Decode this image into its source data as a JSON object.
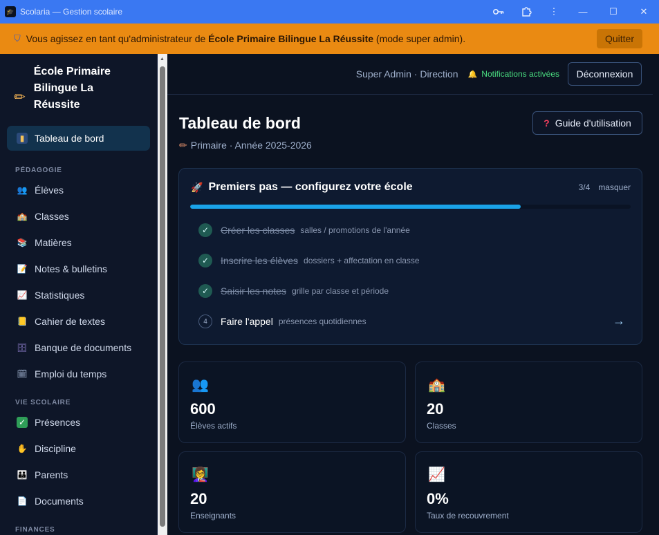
{
  "window": {
    "title": "Scolaria — Gestion scolaire",
    "controls": {
      "minimize": "—",
      "maximize": "☐",
      "close": "✕"
    }
  },
  "banner": {
    "prefix": "Vous agissez en tant qu'administrateur de",
    "school": "École Primaire Bilingue La Réussite",
    "suffix": "(mode super admin).",
    "quit_label": "Quitter"
  },
  "sidebar": {
    "brand": "École Primaire Bilingue La Réussite",
    "active": {
      "label": "Tableau de bord",
      "icon": "chart-icon"
    },
    "sections": [
      {
        "title": "PÉDAGOGIE",
        "items": [
          {
            "label": "Élèves",
            "icon": "students-icon"
          },
          {
            "label": "Classes",
            "icon": "school-icon"
          },
          {
            "label": "Matières",
            "icon": "books-icon"
          },
          {
            "label": "Notes & bulletins",
            "icon": "document-icon"
          },
          {
            "label": "Statistiques",
            "icon": "trend-icon"
          },
          {
            "label": "Cahier de textes",
            "icon": "notebook-icon"
          },
          {
            "label": "Banque de documents",
            "icon": "cabinet-icon"
          },
          {
            "label": "Emploi du temps",
            "icon": "calendar-icon"
          }
        ]
      },
      {
        "title": "VIE SCOLAIRE",
        "items": [
          {
            "label": "Présences",
            "icon": "check-icon"
          },
          {
            "label": "Discipline",
            "icon": "hand-icon"
          },
          {
            "label": "Parents",
            "icon": "family-icon"
          },
          {
            "label": "Documents",
            "icon": "page-icon"
          }
        ]
      },
      {
        "title": "FINANCES",
        "items": []
      }
    ]
  },
  "topbar": {
    "user": "Super Admin · Direction",
    "notifications": "Notifications activées",
    "logout": "Déconnexion"
  },
  "page": {
    "title": "Tableau de bord",
    "subtitle": "Primaire · Année 2025-2026",
    "guide_label": "Guide d'utilisation"
  },
  "onboarding": {
    "title": "Premiers pas — configurez votre école",
    "count": "3/4",
    "hide_label": "masquer",
    "progress": 0.75,
    "steps": [
      {
        "label": "Créer les classes",
        "hint": "salles / promotions de l'année",
        "done": true
      },
      {
        "label": "Inscrire les élèves",
        "hint": "dossiers + affectation en classe",
        "done": true
      },
      {
        "label": "Saisir les notes",
        "hint": "grille par classe et période",
        "done": true
      },
      {
        "number": "4",
        "label": "Faire l'appel",
        "hint": "présences quotidiennes",
        "done": false,
        "arrow": "→"
      }
    ]
  },
  "stats": [
    {
      "value": "600",
      "label": "Élèves actifs",
      "icon": "students-icon"
    },
    {
      "value": "20",
      "label": "Classes",
      "icon": "school-icon"
    },
    {
      "value": "20",
      "label": "Enseignants",
      "icon": "teacher-icon"
    },
    {
      "value": "0%",
      "label": "Taux de recouvrement",
      "icon": "trend-icon"
    }
  ]
}
